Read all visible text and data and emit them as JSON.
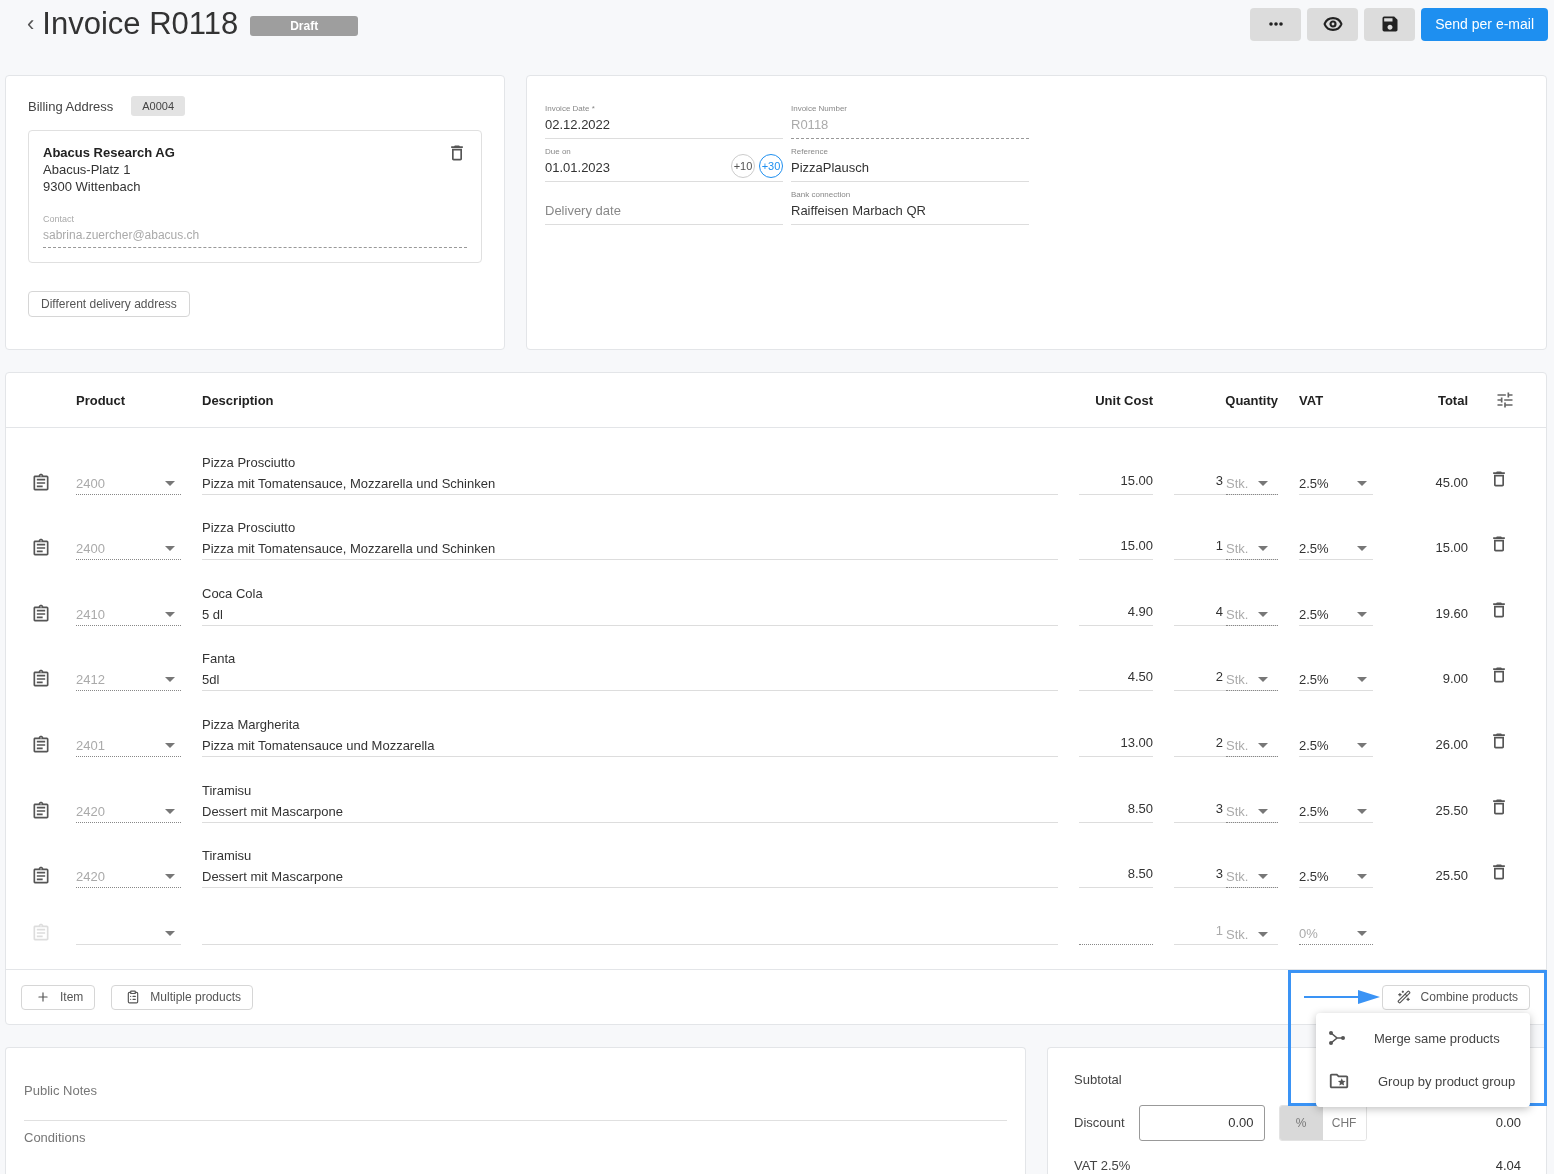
{
  "header": {
    "back": "‹",
    "title": "Invoice R0118",
    "status": "Draft",
    "send_button": "Send per e-mail"
  },
  "billing": {
    "label": "Billing Address",
    "code": "A0004",
    "company": "Abacus Research AG",
    "street": "Abacus-Platz 1",
    "city": "9300 Wittenbach",
    "contact_label": "Contact",
    "contact": "sabrina.zuercher@abacus.ch",
    "delivery_button": "Different delivery address"
  },
  "details": {
    "invoice_date": {
      "label": "Invoice Date *",
      "value": "02.12.2022"
    },
    "invoice_number": {
      "label": "Invoice Number",
      "value": "R0118"
    },
    "due_on": {
      "label": "Due on",
      "value": "01.01.2023",
      "shortcuts": [
        {
          "label": "+10",
          "selected": false
        },
        {
          "label": "+30",
          "selected": true
        }
      ]
    },
    "reference": {
      "label": "Reference",
      "value": "PizzaPlausch"
    },
    "delivery_date": {
      "placeholder": "Delivery date"
    },
    "bank_connection": {
      "label": "Bank connection",
      "value": "Raiffeisen Marbach QR"
    }
  },
  "table": {
    "columns": [
      "Product",
      "Description",
      "Unit Cost",
      "Quantity",
      "VAT",
      "Total"
    ],
    "rows": [
      {
        "kind": "item",
        "product": "2400",
        "name": "Pizza Prosciutto",
        "description": "Pizza mit Tomatensauce, Mozzarella und Schinken",
        "unit_cost": "15.00",
        "quantity": "3",
        "unit": "Stk.",
        "vat": "2.5%",
        "total": "45.00"
      },
      {
        "kind": "item",
        "product": "2400",
        "name": "Pizza Prosciutto",
        "description": "Pizza mit Tomatensauce, Mozzarella und Schinken",
        "unit_cost": "15.00",
        "quantity": "1",
        "unit": "Stk.",
        "vat": "2.5%",
        "total": "15.00"
      },
      {
        "kind": "item",
        "product": "2410",
        "name": "Coca Cola",
        "description": "5 dl",
        "unit_cost": "4.90",
        "quantity": "4",
        "unit": "Stk.",
        "vat": "2.5%",
        "total": "19.60"
      },
      {
        "kind": "item",
        "product": "2412",
        "name": "Fanta",
        "description": "5dl",
        "unit_cost": "4.50",
        "quantity": "2",
        "unit": "Stk.",
        "vat": "2.5%",
        "total": "9.00"
      },
      {
        "kind": "item",
        "product": "2401",
        "name": "Pizza Margherita",
        "description": "Pizza mit Tomatensauce und Mozzarella",
        "unit_cost": "13.00",
        "quantity": "2",
        "unit": "Stk.",
        "vat": "2.5%",
        "total": "26.00"
      },
      {
        "kind": "item",
        "product": "2420",
        "name": "Tiramisu",
        "description": "Dessert mit Mascarpone",
        "unit_cost": "8.50",
        "quantity": "3",
        "unit": "Stk.",
        "vat": "2.5%",
        "total": "25.50"
      },
      {
        "kind": "item",
        "product": "2420",
        "name": "Tiramisu",
        "description": "Dessert mit Mascarpone",
        "unit_cost": "8.50",
        "quantity": "3",
        "unit": "Stk.",
        "vat": "2.5%",
        "total": "25.50"
      },
      {
        "kind": "new",
        "quantity": "1",
        "unit": "Stk.",
        "vat": "0%"
      }
    ]
  },
  "table_actions": {
    "add_item": "Item",
    "multiple_products": "Multiple products",
    "combine": "Combine products",
    "combine_menu": [
      "Merge same products",
      "Group by product group"
    ]
  },
  "notes": {
    "public_notes": "Public Notes",
    "conditions": "Conditions"
  },
  "totals": {
    "subtotal_label": "Subtotal",
    "discount_label": "Discount",
    "discount_value": "0.00",
    "discount_units": [
      {
        "label": "%",
        "selected": true
      },
      {
        "label": "CHF",
        "selected": false
      }
    ],
    "discount_amount": "0.00",
    "vat_label": "VAT 2.5%",
    "vat_amount": "4.04"
  }
}
